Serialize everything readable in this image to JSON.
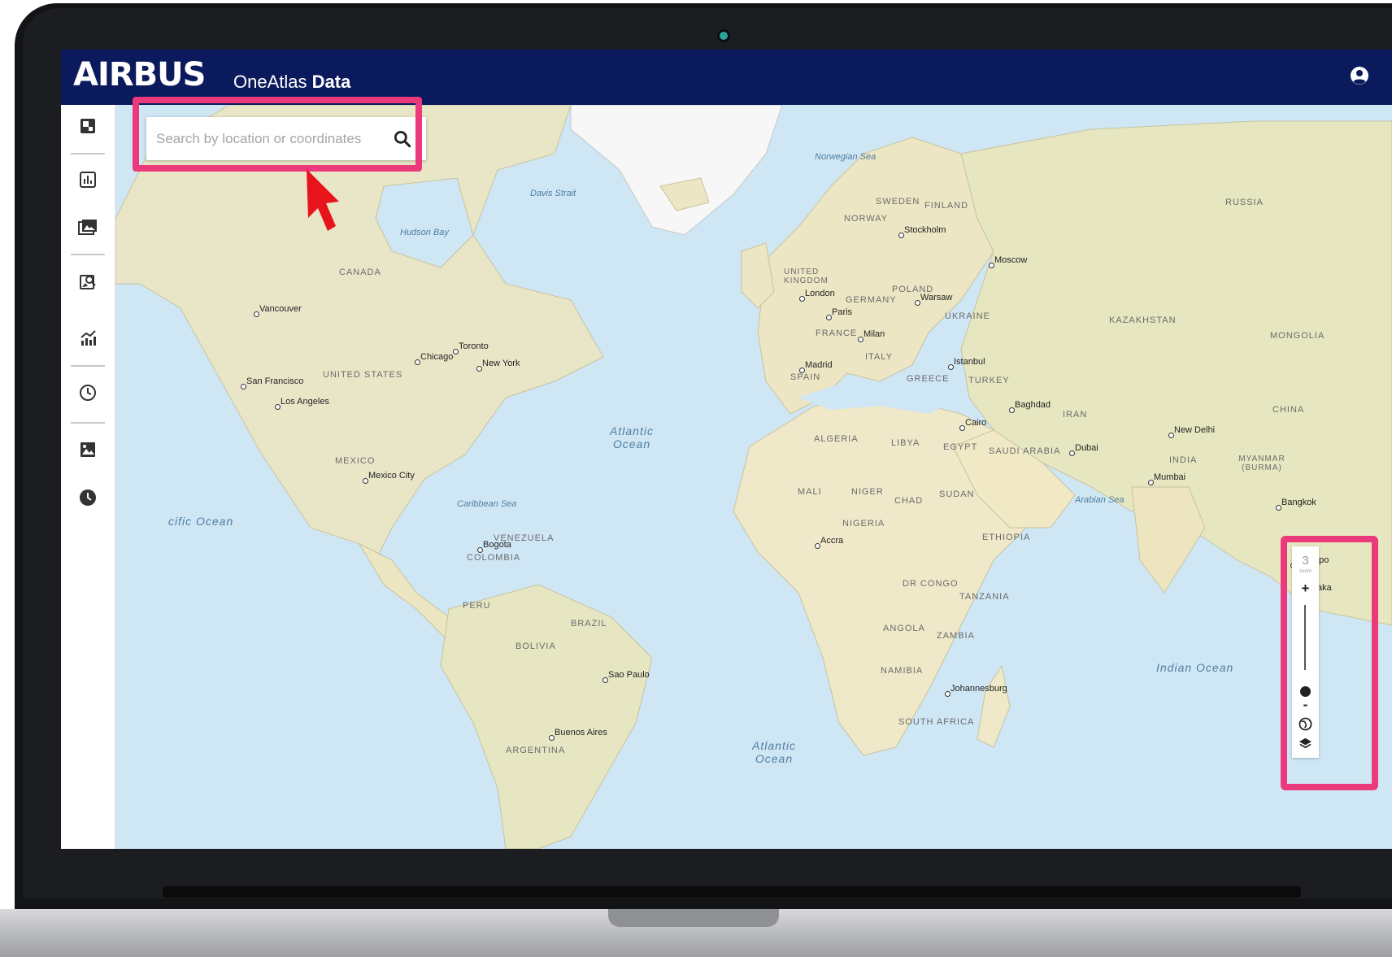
{
  "app": {
    "brand": "AIRBUS",
    "product_prefix": "OneAtlas",
    "product_suffix": "Data"
  },
  "header": {
    "user_icon": "account-circle-icon"
  },
  "search": {
    "placeholder": "Search by location or coordinates",
    "button_icon": "search-icon"
  },
  "sidebar": {
    "items": [
      {
        "icon": "map-layers-icon"
      },
      {
        "icon": "bar-chart-icon"
      },
      {
        "icon": "image-gallery-icon"
      },
      {
        "icon": "image-search-icon"
      },
      {
        "icon": "analytics-icon"
      },
      {
        "icon": "history-icon"
      },
      {
        "icon": "image-icon"
      },
      {
        "icon": "clock-icon"
      }
    ]
  },
  "zoom": {
    "level": "3",
    "caption": "zoom",
    "plus": "+",
    "minus": "-"
  },
  "map": {
    "cities": [
      "Vancouver",
      "San Francisco",
      "Los Angeles",
      "Chicago",
      "Toronto",
      "New York",
      "Mexico City",
      "Bogota",
      "Sao Paulo",
      "Buenos Aires",
      "London",
      "Paris",
      "Madrid",
      "Milan",
      "Stockholm",
      "Warsaw",
      "Moscow",
      "Istanbul",
      "Baghdad",
      "Cairo",
      "Dubai",
      "New Delhi",
      "Mumbai",
      "Bangkok",
      "Accra",
      "Johannesburg",
      "Singapo",
      "aka"
    ],
    "countries": [
      "CANADA",
      "UNITED STATES",
      "MEXICO",
      "VENEZUELA",
      "COLOMBIA",
      "PERU",
      "BRAZIL",
      "BOLIVIA",
      "ARGENTINA",
      "UNITED KINGDOM",
      "SWEDEN",
      "FINLAND",
      "NORWAY",
      "POLAND",
      "GERMANY",
      "UKRAINE",
      "FRANCE",
      "SPAIN",
      "ITALY",
      "GREECE",
      "TURKEY",
      "RUSSIA",
      "KAZAKHSTAN",
      "MONGOLIA",
      "CHINA",
      "IRAN",
      "SAUDI ARABIA",
      "EGYPT",
      "LIBYA",
      "ALGERIA",
      "MALI",
      "NIGER",
      "CHAD",
      "SUDAN",
      "NIGERIA",
      "ETHIOPIA",
      "DR CONGO",
      "TANZANIA",
      "ANGOLA",
      "ZAMBIA",
      "NAMIBIA",
      "SOUTH AFRICA",
      "INDIA",
      "MYANMAR (BURMA)"
    ],
    "oceans": [
      "Atlantic Ocean",
      "Atlantic Ocean",
      "Indian Ocean",
      "cific Ocean"
    ],
    "seas": [
      "Norwegian Sea",
      "Davis Strait",
      "Hudson Bay",
      "Caribbean Sea",
      "Arabian Sea"
    ]
  },
  "colors": {
    "header_bg": "#0a1a5c",
    "highlight": "#ea3a7c",
    "arrow": "#e8141b",
    "ocean": "#cfe6f5",
    "land": "#efe8c9"
  }
}
